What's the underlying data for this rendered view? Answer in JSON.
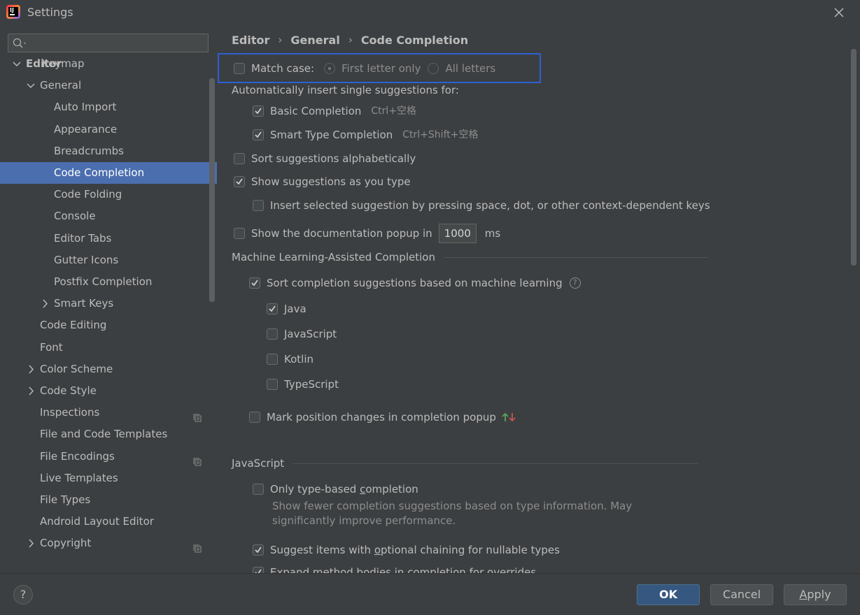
{
  "window": {
    "title": "Settings"
  },
  "sidebar": {
    "search_placeholder": "",
    "partial_item": "Keymap",
    "items": [
      {
        "label": "Editor",
        "level": 0,
        "expanded": true
      },
      {
        "label": "General",
        "level": 1,
        "expanded": true
      },
      {
        "label": "Auto Import",
        "level": 2
      },
      {
        "label": "Appearance",
        "level": 2
      },
      {
        "label": "Breadcrumbs",
        "level": 2
      },
      {
        "label": "Code Completion",
        "level": 2,
        "selected": true
      },
      {
        "label": "Code Folding",
        "level": 2
      },
      {
        "label": "Console",
        "level": 2
      },
      {
        "label": "Editor Tabs",
        "level": 2
      },
      {
        "label": "Gutter Icons",
        "level": 2
      },
      {
        "label": "Postfix Completion",
        "level": 2
      },
      {
        "label": "Smart Keys",
        "level": 2,
        "collapsed": true
      },
      {
        "label": "Code Editing",
        "level": 1
      },
      {
        "label": "Font",
        "level": 1
      },
      {
        "label": "Color Scheme",
        "level": 1,
        "collapsed": true
      },
      {
        "label": "Code Style",
        "level": 1,
        "collapsed": true
      },
      {
        "label": "Inspections",
        "level": 1,
        "badge": true
      },
      {
        "label": "File and Code Templates",
        "level": 1
      },
      {
        "label": "File Encodings",
        "level": 1,
        "badge": true
      },
      {
        "label": "Live Templates",
        "level": 1
      },
      {
        "label": "File Types",
        "level": 1
      },
      {
        "label": "Android Layout Editor",
        "level": 1
      },
      {
        "label": "Copyright",
        "level": 1,
        "collapsed": true,
        "badge": true
      }
    ]
  },
  "breadcrumb": [
    "Editor",
    "General",
    "Code Completion"
  ],
  "content": {
    "match_case": {
      "label": "Match case:",
      "checked": false,
      "options": [
        "First letter only",
        "All letters"
      ],
      "selected": 0
    },
    "auto_insert_label": "Automatically insert single suggestions for:",
    "basic_completion": {
      "label": "Basic Completion",
      "shortcut": "Ctrl+空格",
      "checked": true
    },
    "smart_type_completion": {
      "label": "Smart Type Completion",
      "shortcut": "Ctrl+Shift+空格",
      "checked": true
    },
    "sort_alpha": {
      "label": "Sort suggestions alphabetically",
      "checked": false
    },
    "show_as_you_type": {
      "label": "Show suggestions as you type",
      "checked": true
    },
    "insert_selected": {
      "label": "Insert selected suggestion by pressing space, dot, or other context-dependent keys",
      "checked": false
    },
    "doc_popup": {
      "label": "Show the documentation popup in",
      "value": "1000",
      "unit": "ms",
      "checked": false
    },
    "ml_section": "Machine Learning-Assisted Completion",
    "ml_sort": {
      "label": "Sort completion suggestions based on machine learning",
      "checked": true
    },
    "ml_languages": [
      {
        "label": "Java",
        "checked": true
      },
      {
        "label": "JavaScript",
        "checked": false
      },
      {
        "label": "Kotlin",
        "checked": false
      },
      {
        "label": "TypeScript",
        "checked": false
      }
    ],
    "mark_position": {
      "label": "Mark position changes in completion popup",
      "checked": false
    },
    "js_section": "JavaScript",
    "type_based": {
      "label_pre": "Only type-based ",
      "label_u": "c",
      "label_post": "ompletion",
      "checked": false,
      "description": "Show fewer completion suggestions based on type information. May significantly improve performance."
    },
    "optional_chaining": {
      "label_pre": "Suggest items with ",
      "label_u": "o",
      "label_post": "ptional chaining for nullable types",
      "checked": true
    },
    "expand_method": {
      "label": "Expand method bodies in completion for overrides",
      "checked": true
    }
  },
  "footer": {
    "help": "?",
    "ok": "OK",
    "cancel": "Cancel",
    "apply_u": "A",
    "apply_rest": "pply"
  },
  "colors": {
    "accent": "#4b6eaf",
    "primary_button": "#365880",
    "highlight_box": "#2d5fd6"
  }
}
